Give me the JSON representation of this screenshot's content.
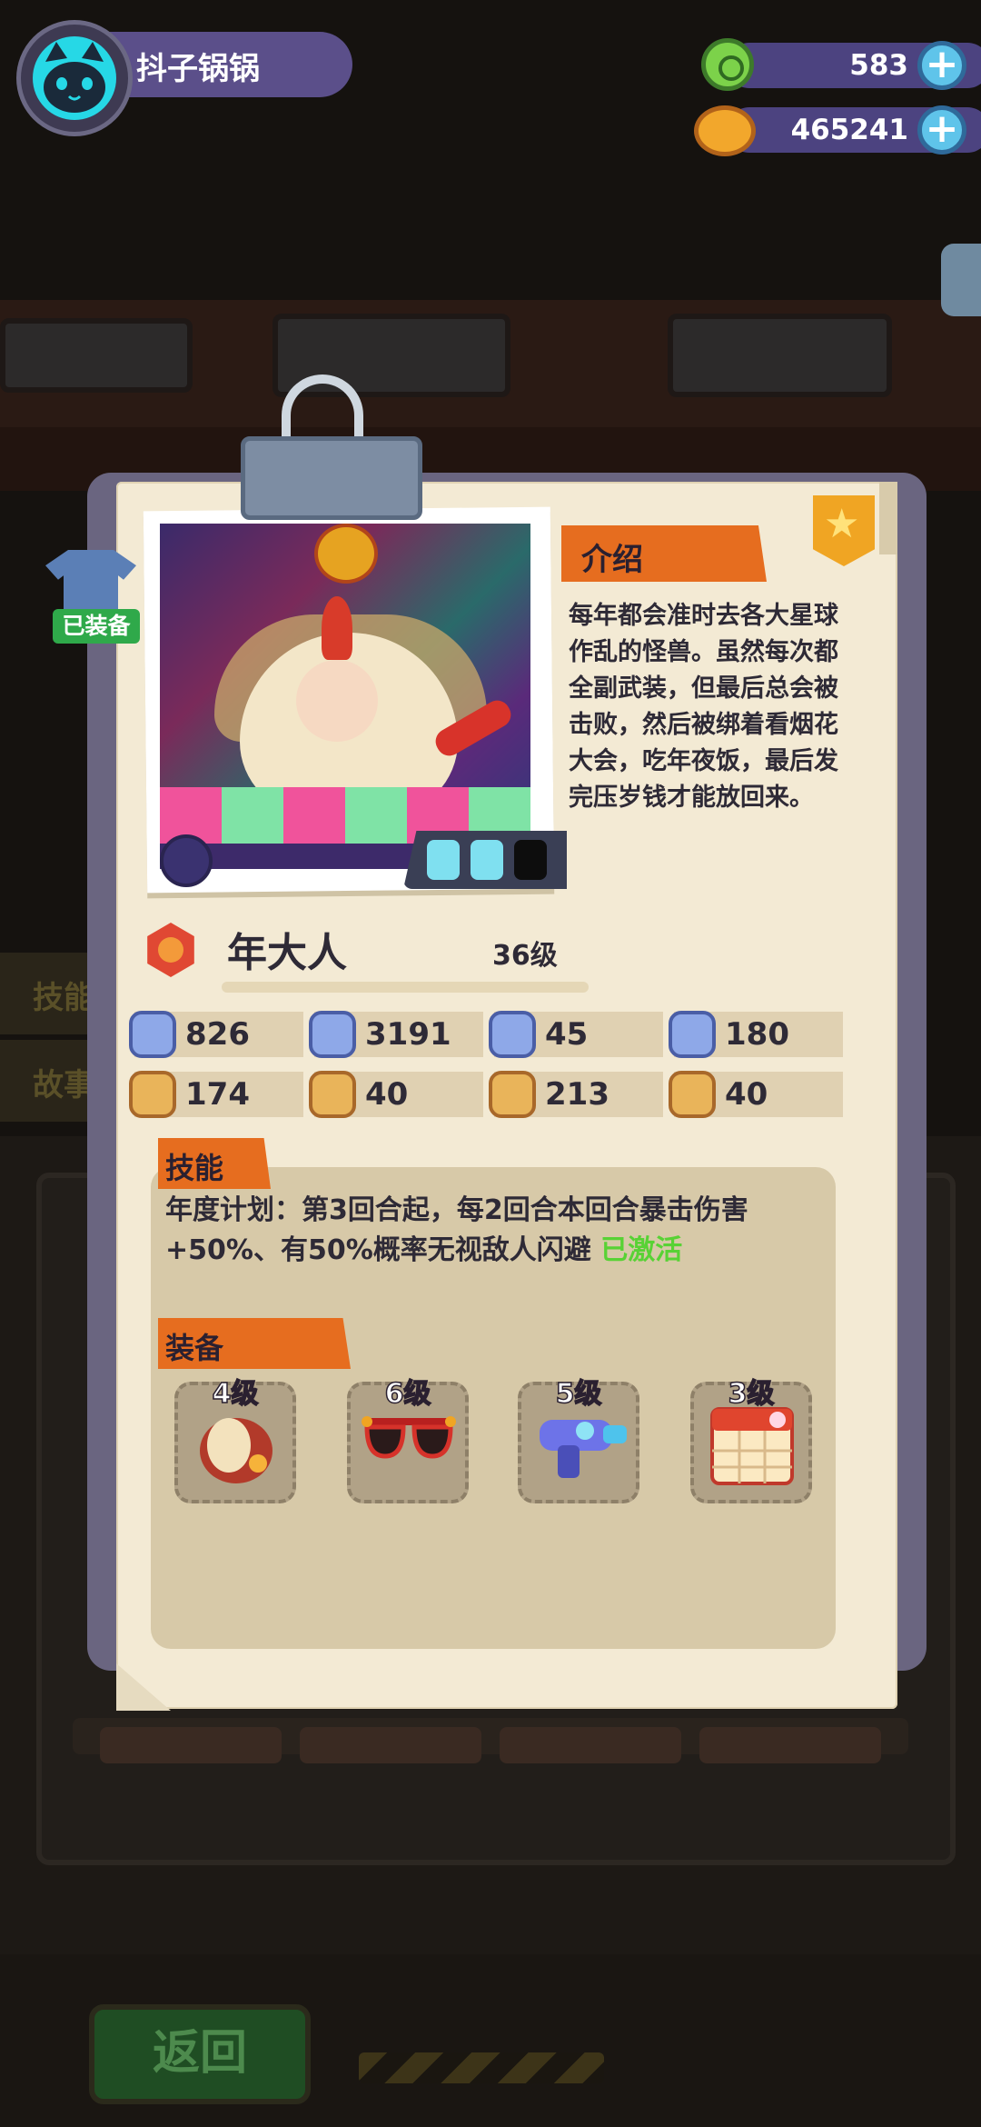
{
  "player": {
    "name": "抖子锅锅"
  },
  "currencies": [
    {
      "icon": "green-gem-icon",
      "value": "583",
      "add_label": "+"
    },
    {
      "icon": "planet-coin-icon",
      "value": "465241",
      "add_label": "+"
    }
  ],
  "hero": {
    "name": "年大人",
    "level": "36级",
    "equipped_label": "已装备",
    "energy_filled": 2,
    "energy_total": 3
  },
  "intro": {
    "title": "介绍",
    "text": "每年都会准时去各大星球作乱的怪兽。虽然每次都全副武装，但最后总会被击败，然后被绑着看烟花大会，吃年夜饭，最后发完压岁钱才能放回来。"
  },
  "stats": [
    {
      "icon": "heart-shield-icon",
      "value": "826"
    },
    {
      "icon": "sword-shield-icon",
      "value": "3191"
    },
    {
      "icon": "defense-shield-icon",
      "value": "45"
    },
    {
      "icon": "speed-shield-icon",
      "value": "180"
    },
    {
      "icon": "fist-icon",
      "value": "174"
    },
    {
      "icon": "smile-icon",
      "value": "40"
    },
    {
      "icon": "muscle-icon",
      "value": "213"
    },
    {
      "icon": "brain-icon",
      "value": "40"
    }
  ],
  "skill": {
    "title": "技能",
    "text": "年度计划：第3回合起，每2回合本回合暴击伤害+50%、有50%概率无视敌人闪避",
    "status": "已激活"
  },
  "equipment": {
    "title": "装备",
    "items": [
      {
        "icon": "lion-mane-hat-icon",
        "level": "4级"
      },
      {
        "icon": "heart-sunglasses-icon",
        "level": "6级"
      },
      {
        "icon": "water-gun-icon",
        "level": "5级"
      },
      {
        "icon": "calendar-icon",
        "level": "3级"
      }
    ]
  },
  "background": {
    "side_tab_1": "技能",
    "side_tab_2": "故事",
    "back_button": "返回"
  },
  "colors": {
    "accent_orange": "#e66d1f",
    "paper": "#f3ead4",
    "frame": "#6a6580",
    "activated_green": "#58d235"
  }
}
